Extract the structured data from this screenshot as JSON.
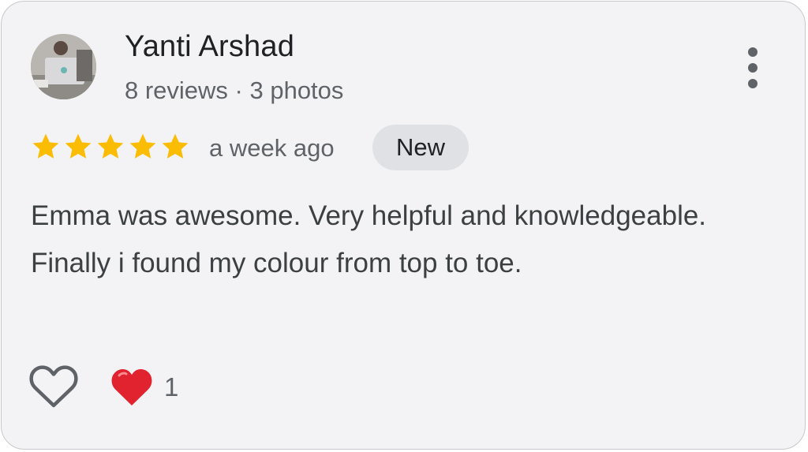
{
  "review": {
    "author_name": "Yanti Arshad",
    "author_meta": "8 reviews · 3 photos",
    "rating": 5,
    "rating_max": 5,
    "time": "a week ago",
    "badge": "New",
    "text": "Emma was awesome. Very helpful and knowledgeable. Finally i found my colour from top to toe.",
    "reactions": {
      "count": "1",
      "icon": "red-heart-icon"
    },
    "icons": {
      "avatar": "avatar-photo",
      "more": "more-vert-icon",
      "like": "heart-outline-icon",
      "star": "star-icon"
    }
  },
  "colors": {
    "card_background": "#f3f3f5",
    "star": "#fbbc04",
    "badge_background": "#dfe1e5",
    "reaction_heart": "#e0232e"
  }
}
